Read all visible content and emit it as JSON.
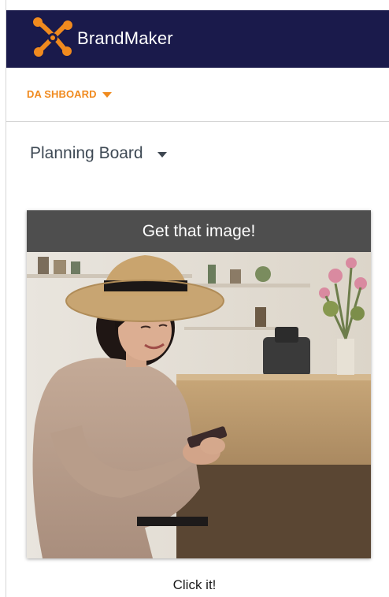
{
  "header": {
    "brand_name": "BrandMaker",
    "logo_icon": "brandmaker-x-logo",
    "bg_color": "#1a1a4b",
    "accent_color": "#f08a1e"
  },
  "nav": {
    "dashboard_label": "DA SHBOARD",
    "dashboard_icon": "caret-down-icon"
  },
  "board": {
    "selected_label": "Planning Board",
    "dropdown_icon": "caret-down-icon"
  },
  "card": {
    "header_text": "Get that image!",
    "image_subject": "woman-in-hat-with-phone-photo",
    "caption": "Click it!"
  }
}
